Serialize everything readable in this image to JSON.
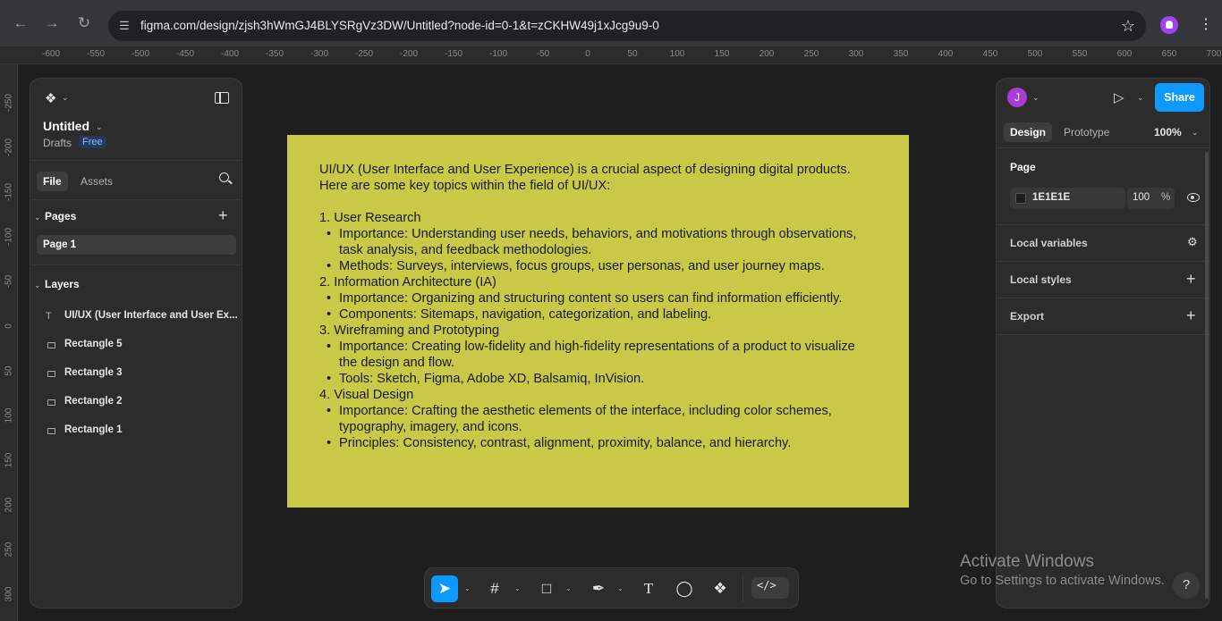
{
  "browser": {
    "url": "figma.com/design/zjsh3hWmGJ4BLYSRgVz3DW/Untitled?node-id=0-1&t=zCKHW49j1xJcg9u9-0",
    "back_icon": "arrow-left-icon",
    "forward_icon": "arrow-right-icon",
    "reload_icon": "reload-icon"
  },
  "rulers": {
    "top": [
      "-600",
      "-550",
      "-500",
      "-450",
      "-400",
      "-350",
      "-300",
      "-250",
      "-200",
      "-150",
      "-100",
      "-50",
      "0",
      "50",
      "100",
      "150",
      "200",
      "250",
      "300",
      "350",
      "400",
      "450",
      "500",
      "550",
      "600",
      "650",
      "700"
    ],
    "left": [
      "-250",
      "-200",
      "-150",
      "-100",
      "-50",
      "0",
      "50",
      "100",
      "150",
      "200",
      "250",
      "300"
    ]
  },
  "left_panel": {
    "file_title": "Untitled",
    "drafts": "Drafts",
    "plan_badge": "Free",
    "tabs": {
      "file": "File",
      "assets": "Assets"
    },
    "pages_header": "Pages",
    "pages": [
      "Page 1"
    ],
    "layers_header": "Layers",
    "layers": [
      {
        "label": "UI/UX (User Interface and User Ex...",
        "icon": "text-icon"
      },
      {
        "label": "Rectangle 5",
        "icon": "rectangle-icon"
      },
      {
        "label": "Rectangle 3",
        "icon": "rectangle-icon"
      },
      {
        "label": "Rectangle 2",
        "icon": "rectangle-icon"
      },
      {
        "label": "Rectangle 1",
        "icon": "rectangle-icon"
      }
    ]
  },
  "right_panel": {
    "avatar_initial": "J",
    "share_label": "Share",
    "tabs": {
      "design": "Design",
      "prototype": "Prototype"
    },
    "zoom": "100%",
    "page_section": "Page",
    "page_color": "1E1E1E",
    "page_opacity": "100",
    "opacity_unit": "%",
    "local_variables": "Local variables",
    "local_styles": "Local styles",
    "export": "Export"
  },
  "canvas": {
    "frame_color": "#c8c947",
    "intro": "UI/UX (User Interface and User Experience) is a crucial aspect of designing digital products. Here are some key topics within the field of UI/UX:",
    "sections": [
      {
        "heading": "1. User Research",
        "bullets": [
          "Importance: Understanding user needs, behaviors, and motivations through observations, task analysis, and feedback methodologies.",
          "Methods: Surveys, interviews, focus groups, user personas, and user journey maps."
        ]
      },
      {
        "heading": "2. Information Architecture (IA)",
        "bullets": [
          "Importance: Organizing and structuring content so users can find information efficiently.",
          "Components: Sitemaps, navigation, categorization, and labeling."
        ]
      },
      {
        "heading": "3. Wireframing and Prototyping",
        "bullets": [
          "Importance: Creating low-fidelity and high-fidelity representations of a product to visualize the design and flow.",
          "Tools: Sketch, Figma, Adobe XD, Balsamiq, InVision."
        ]
      },
      {
        "heading": "4. Visual Design",
        "bullets": [
          "Importance: Crafting the aesthetic elements of the interface, including color schemes, typography, imagery, and icons.",
          "Principles: Consistency, contrast, alignment, proximity, balance, and hierarchy."
        ]
      }
    ]
  },
  "toolbar": {
    "tools": [
      "move-tool",
      "frame-tool",
      "shape-tool",
      "pen-tool",
      "text-tool",
      "comment-tool",
      "actions-tool"
    ],
    "dev_mode_label": "</>"
  },
  "overlay": {
    "activate_title": "Activate Windows",
    "activate_sub": "Go to Settings to activate Windows.",
    "help": "?"
  },
  "colors": {
    "accent": "#0d99ff",
    "canvas_bg": "#1e1e1e",
    "panel_bg": "#2c2c2c"
  }
}
